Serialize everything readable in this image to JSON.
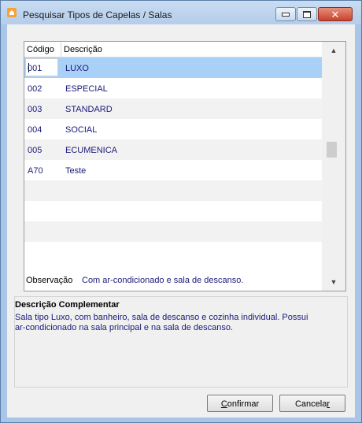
{
  "window": {
    "title": "Pesquisar Tipos de Capelas / Salas",
    "controls": {
      "minimize": "minimize-icon",
      "maximize": "maximize-icon",
      "close": "close-icon"
    }
  },
  "grid": {
    "columns": [
      "Código",
      "Descrição"
    ],
    "rows": [
      {
        "code": "001",
        "desc": "LUXO",
        "selected": true
      },
      {
        "code": "002",
        "desc": "ESPECIAL"
      },
      {
        "code": "003",
        "desc": "STANDARD"
      },
      {
        "code": "004",
        "desc": "SOCIAL"
      },
      {
        "code": "005",
        "desc": "ECUMENICA"
      },
      {
        "code": "A70",
        "desc": "Teste"
      }
    ]
  },
  "observacao": {
    "label": "Observação",
    "value": "Com ar-condicionado e sala de descanso."
  },
  "complementar": {
    "title": "Descrição Complementar",
    "line1": "Sala tipo Luxo, com banheiro, sala de descanso e cozinha individual. Possui",
    "line2": "ar-condicionado na sala principal e na sala de descanso."
  },
  "buttons": {
    "confirm_first": "C",
    "confirm_rest": "onfirmar",
    "cancel_first": "Cancela",
    "cancel_last": "r"
  },
  "colors": {
    "selection": "#a9d1f7",
    "text_value": "#1a1a7a"
  }
}
